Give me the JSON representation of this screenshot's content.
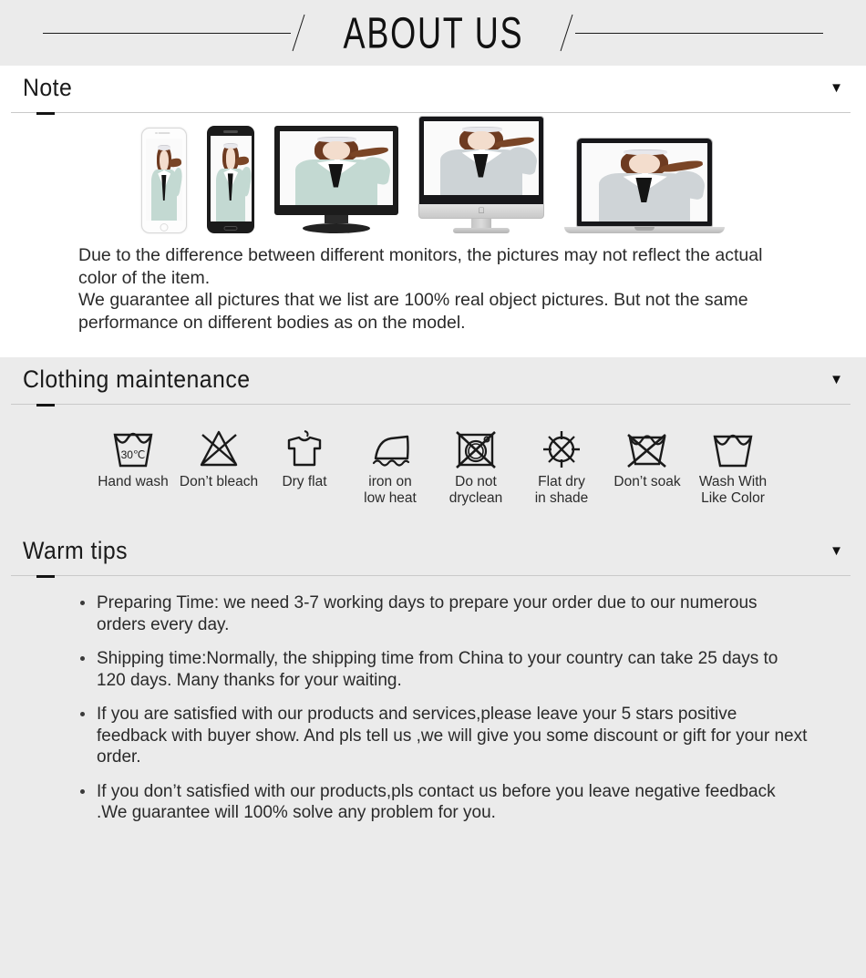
{
  "header": {
    "title": "ABOUT US",
    "left_rule": "horizontal-rule",
    "right_rule": "horizontal-rule"
  },
  "sections": [
    {
      "id": "note",
      "title": "Note",
      "caret": "▼",
      "background": "#ffffff"
    },
    {
      "id": "clothing-maintenance",
      "title": "Clothing maintenance",
      "caret": "▼",
      "background": "#ebebeb"
    },
    {
      "id": "warm-tips",
      "title": "Warm tips",
      "caret": "▼",
      "background": "#ebebeb"
    }
  ],
  "devices": [
    {
      "name": "iphone",
      "label": "white-smartphone",
      "coat_color": "#c3d9d2"
    },
    {
      "name": "android",
      "label": "black-smartphone",
      "coat_color": "#c3d9d2"
    },
    {
      "name": "monitor",
      "label": "black-desktop-monitor",
      "coat_color": "#c3d9d2"
    },
    {
      "name": "imac",
      "label": "silver-all-in-one-desktop",
      "coat_color": "#cdd3d6"
    },
    {
      "name": "macbook",
      "label": "silver-laptop",
      "coat_color": "#cfd4d7"
    }
  ],
  "note": {
    "paragraphs": [
      "Due to the difference between different monitors, the pictures may not reflect the actual color of the item.",
      "We guarantee all pictures that we list are 100% real object pictures. But not the same performance on different bodies as on the model."
    ]
  },
  "care_icons": [
    {
      "icon": "hand-wash-tub-icon",
      "label": "Hand wash",
      "temperature": "30℃"
    },
    {
      "icon": "do-not-bleach-icon",
      "label": "Don’t bleach"
    },
    {
      "icon": "dry-flat-shirt-icon",
      "label": "Dry flat"
    },
    {
      "icon": "iron-low-heat-icon",
      "label": "iron on\nlow heat"
    },
    {
      "icon": "do-not-dryclean-icon",
      "label": "Do not\ndryclean"
    },
    {
      "icon": "flat-dry-in-shade-icon",
      "label": "Flat dry\nin shade"
    },
    {
      "icon": "do-not-soak-icon",
      "label": "Don’t soak"
    },
    {
      "icon": "wash-with-like-color-icon",
      "label": "Wash With\nLike Color"
    }
  ],
  "warm_tips": [
    "Preparing Time: we need 3-7 working days to prepare your order due to our numerous orders every day.",
    "Shipping time:Normally, the shipping time from China to your country can take 25 days to 120 days. Many thanks for your waiting.",
    "If you are satisfied with our products and services,please leave your 5 stars positive feedback with buyer show. And pls tell us ,we will give you some discount or gift for your next order.",
    "If you don’t satisfied with our products,pls contact us before you leave negative feedback .We guarantee will 100% solve any problem for you."
  ],
  "colors": {
    "page_background": "#ebebeb",
    "panel_background": "#ffffff",
    "text": "#2a2a2a",
    "rule": "#c9c9c9",
    "accent": "#141414"
  }
}
